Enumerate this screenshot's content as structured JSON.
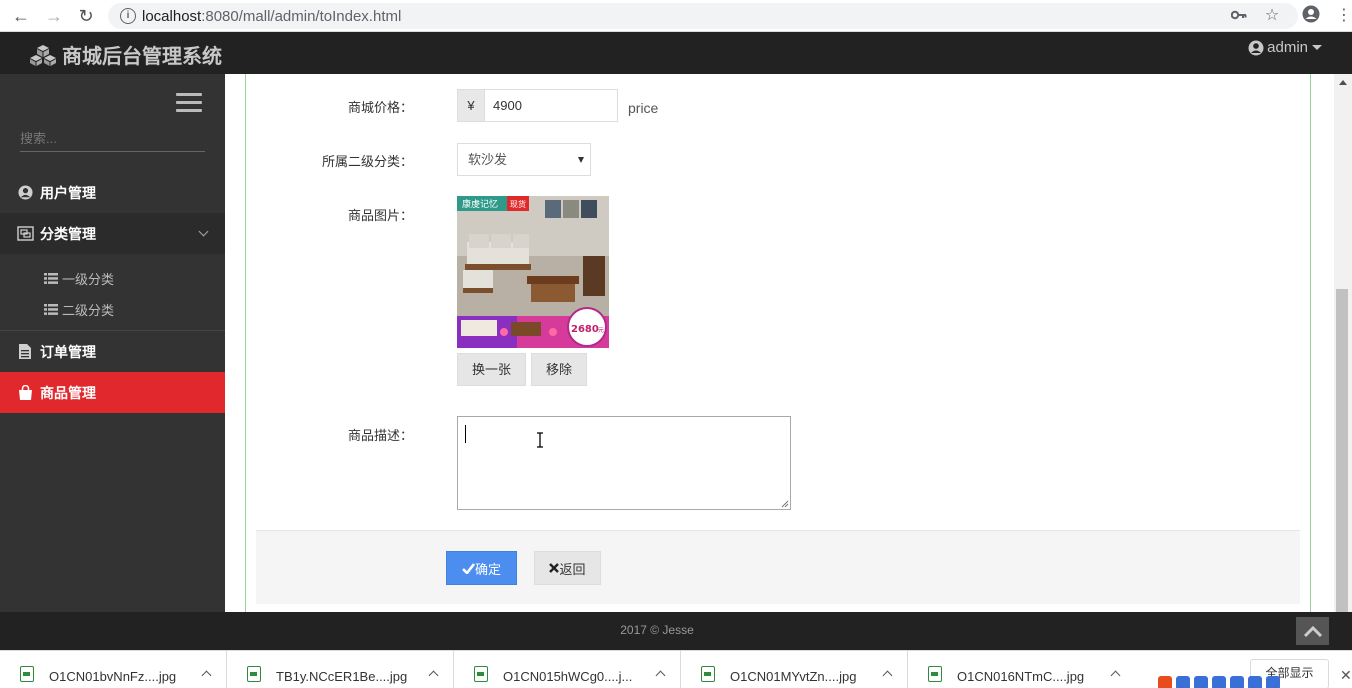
{
  "browser": {
    "url_host": "localhost",
    "url_path": ":8080/mall/admin/toIndex.html"
  },
  "header": {
    "brand": "商城后台管理系统",
    "user": "admin"
  },
  "sidebar": {
    "search_placeholder": "搜索...",
    "items": [
      {
        "label": "用户管理"
      },
      {
        "label": "分类管理"
      },
      {
        "label": "订单管理"
      },
      {
        "label": "商品管理"
      }
    ],
    "subitems": [
      {
        "label": "一级分类"
      },
      {
        "label": "二级分类"
      }
    ]
  },
  "form": {
    "price_label": "商城价格：",
    "currency_symbol": "¥",
    "price_value": "4900",
    "price_help": "price",
    "category_label": "所属二级分类：",
    "category_value": "软沙发",
    "image_label": "商品图片：",
    "image_text": {
      "brand": "康虔记忆",
      "badge": "现货",
      "promo": "2680",
      "promo_unit": "元"
    },
    "change_button": "换一张",
    "remove_button": "移除",
    "desc_label": "商品描述：",
    "desc_value": "",
    "submit_button": "确定",
    "back_button": "返回"
  },
  "footer": {
    "copyright": "2017 © Jesse"
  },
  "downloads": {
    "files": [
      {
        "name": "O1CN01bvNnFz....jpg"
      },
      {
        "name": "TB1y.NCcER1Be....jpg"
      },
      {
        "name": "O1CN015hWCg0....j..."
      },
      {
        "name": "O1CN01MYvtZn....jpg"
      },
      {
        "name": "O1CN016NTmC....jpg"
      }
    ],
    "show_all": "全部显示"
  },
  "colors": {
    "accent_red": "#e0282d",
    "primary_blue": "#4b8ef0",
    "sidebar_bg": "#333333",
    "header_bg": "#222222"
  }
}
